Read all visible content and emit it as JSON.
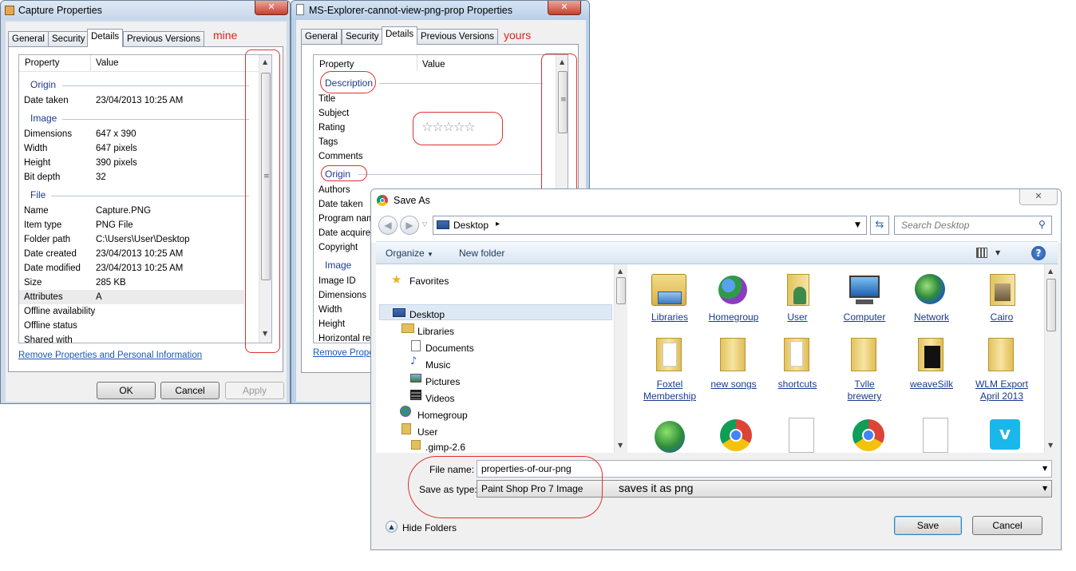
{
  "win1": {
    "title": "Capture Properties",
    "close": "✕",
    "tabs": [
      "General",
      "Security",
      "Details",
      "Previous Versions"
    ],
    "annotation": "mine",
    "col_property": "Property",
    "col_value": "Value",
    "sections": {
      "origin": "Origin",
      "image": "Image",
      "file": "File"
    },
    "rows": {
      "date_taken": [
        "Date taken",
        "23/04/2013 10:25 AM"
      ],
      "dimensions": [
        "Dimensions",
        "647 x 390"
      ],
      "width": [
        "Width",
        "647 pixels"
      ],
      "height": [
        "Height",
        "390 pixels"
      ],
      "bit_depth": [
        "Bit depth",
        "32"
      ],
      "name": [
        "Name",
        "Capture.PNG"
      ],
      "item_type": [
        "Item type",
        "PNG File"
      ],
      "folder_path": [
        "Folder path",
        "C:\\Users\\User\\Desktop"
      ],
      "date_created": [
        "Date created",
        "23/04/2013 10:25 AM"
      ],
      "date_modified": [
        "Date modified",
        "23/04/2013 10:25 AM"
      ],
      "size": [
        "Size",
        "285 KB"
      ],
      "attributes": [
        "Attributes",
        "A"
      ],
      "offline_availability": [
        "Offline availability",
        ""
      ],
      "offline_status": [
        "Offline status",
        ""
      ],
      "shared_with": [
        "Shared with",
        ""
      ]
    },
    "remove_link": "Remove Properties and Personal Information",
    "ok": "OK",
    "cancel": "Cancel",
    "apply": "Apply"
  },
  "win2": {
    "title": "MS-Explorer-cannot-view-png-prop Properties",
    "close": "✕",
    "tabs": [
      "General",
      "Security",
      "Details",
      "Previous Versions"
    ],
    "annotation": "yours",
    "col_property": "Property",
    "col_value": "Value",
    "sections": {
      "description": "Description",
      "origin": "Origin",
      "image": "Image"
    },
    "rows": [
      "Title",
      "Subject",
      "Rating",
      "Tags",
      "Comments",
      "Authors",
      "Date taken",
      "Program name",
      "Date acquired",
      "Copyright",
      "Image ID",
      "Dimensions",
      "Width",
      "Height",
      "Horizontal resolution"
    ],
    "rating_stars": "☆☆☆☆☆",
    "remove_link": "Remove Properties and Personal Information"
  },
  "saveas": {
    "title": "Save As",
    "close": "✕",
    "location": "Desktop",
    "search_placeholder": "Search Desktop",
    "organize": "Organize",
    "new_folder": "New folder",
    "help": "?",
    "nav": {
      "favorites": "Favorites",
      "desktop": "Desktop",
      "libraries": "Libraries",
      "documents": "Documents",
      "music": "Music",
      "pictures": "Pictures",
      "videos": "Videos",
      "homegroup": "Homegroup",
      "user": "User",
      "gimp": ".gimp-2.6"
    },
    "tiles": {
      "libraries": "Libraries",
      "homegroup": "Homegroup",
      "user": "User",
      "computer": "Computer",
      "network": "Network",
      "cairo": "Cairo",
      "foxtel": "Foxtel Membership",
      "new_songs": "new songs",
      "shortcuts": "shortcuts",
      "tvlle": "Tvlle brewery",
      "weavesilk": "weaveSilk",
      "wlm": "WLM Export April 2013"
    },
    "file_name_label": "File name:",
    "file_name_value": "properties-of-our-png",
    "save_type_label": "Save as type:",
    "save_type_value": "Paint Shop Pro 7 Image",
    "annotation": "saves it as png",
    "hide_folders": "Hide Folders",
    "save": "Save",
    "cancel": "Cancel"
  }
}
